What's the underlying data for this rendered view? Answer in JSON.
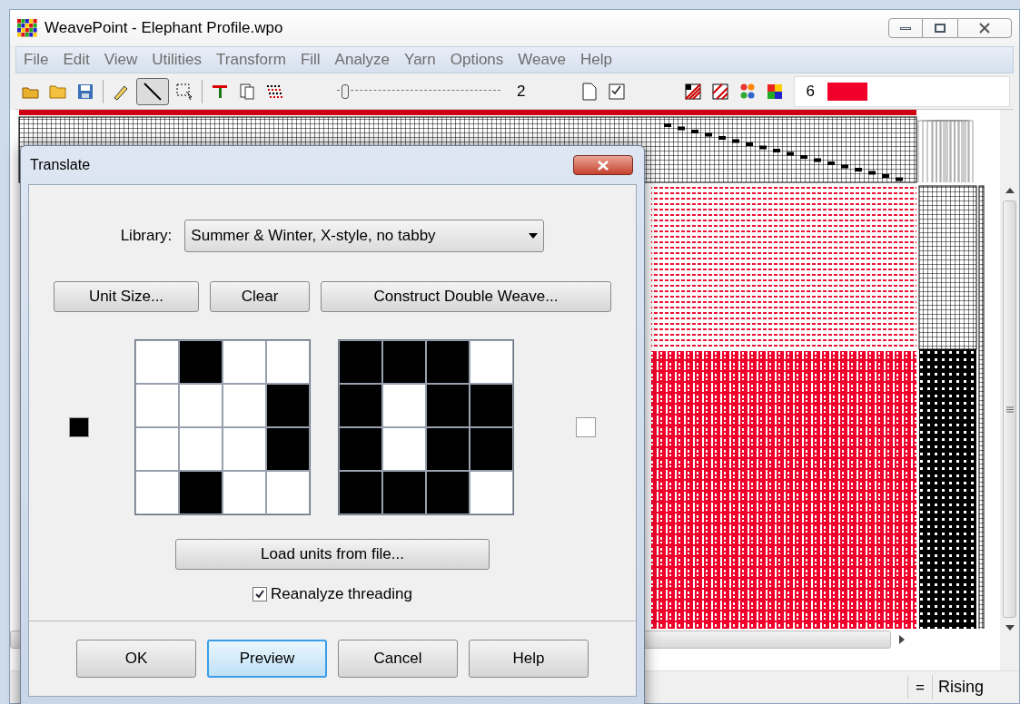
{
  "window": {
    "title": "WeavePoint - Elephant Profile.wpo"
  },
  "menu": [
    "File",
    "Edit",
    "View",
    "Utilities",
    "Transform",
    "Fill",
    "Analyze",
    "Yarn",
    "Options",
    "Weave",
    "Help"
  ],
  "toolbar": {
    "slider": {
      "level": 0.05
    },
    "slider_value": "2",
    "color_index": "6",
    "color_swatch": {
      "color": "#f0002a"
    }
  },
  "status_bar": {
    "sign": "=",
    "mode": "Rising"
  },
  "dialog": {
    "title": "Translate",
    "library_label": "Library:",
    "library_value": "Summer & Winter, X-style, no tabby",
    "buttons": [
      "Unit Size...",
      "Clear",
      "Construct Double Weave..."
    ],
    "left_swatch": {
      "color": "#000000"
    },
    "right_swatch": {
      "color": "#ffffff"
    },
    "units": [
      {
        "rows": [
          [
            false,
            true,
            false,
            false
          ],
          [
            false,
            false,
            false,
            true
          ],
          [
            false,
            false,
            false,
            true
          ],
          [
            false,
            true,
            false,
            false
          ]
        ]
      },
      {
        "rows": [
          [
            true,
            true,
            true,
            false
          ],
          [
            true,
            false,
            true,
            true
          ],
          [
            true,
            false,
            true,
            true
          ],
          [
            true,
            true,
            true,
            false
          ]
        ]
      }
    ],
    "load_button": "Load units from file...",
    "reanalyze": {
      "label": "Reanalyze threading",
      "checked": true
    },
    "footer_buttons": [
      {
        "label": "OK",
        "focused": false
      },
      {
        "label": "Preview",
        "focused": true
      },
      {
        "label": "Cancel",
        "focused": false
      },
      {
        "label": "Help",
        "focused": false
      }
    ]
  }
}
